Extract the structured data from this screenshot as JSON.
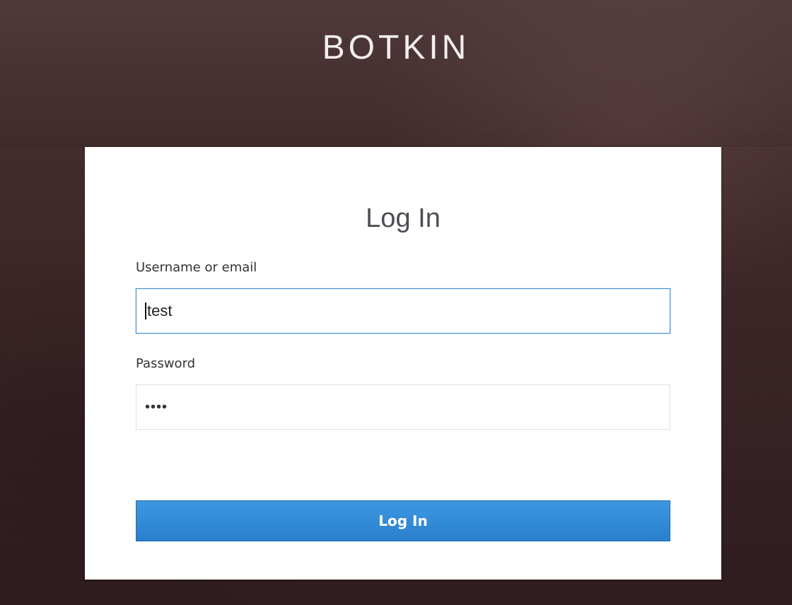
{
  "brand": {
    "name": "BOTKIN"
  },
  "login": {
    "title": "Log In",
    "username": {
      "label": "Username or email",
      "value": "test"
    },
    "password": {
      "label": "Password",
      "masked_value": "••••"
    },
    "submit_label": "Log In"
  },
  "colors": {
    "background": "#3b2527",
    "card": "#ffffff",
    "primary_button": "#2a7fcd",
    "focus_border": "#3a8ed6"
  }
}
